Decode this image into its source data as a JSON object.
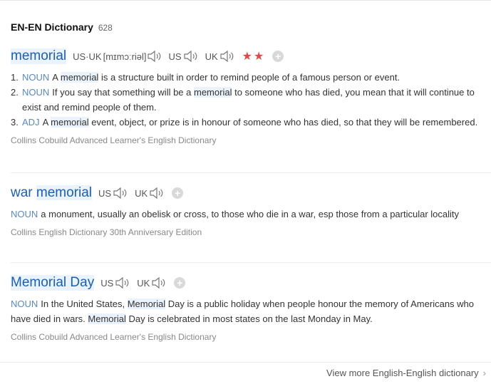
{
  "header": {
    "title": "EN-EN Dictionary",
    "count": "628"
  },
  "entry1": {
    "headword": "memorial",
    "pron_label": "US·UK",
    "ipa": "[mɪmɔːriəl]",
    "us": "US",
    "uk": "UK",
    "stars": "★★",
    "defs": [
      {
        "num": "1.",
        "pos": "NOUN",
        "pre": "A ",
        "hl": "memorial",
        "post": " is a structure built in order to remind people of a famous person or event."
      },
      {
        "num": "2.",
        "pos": "NOUN",
        "pre": "If you say that something will be a ",
        "hl": "memorial",
        "post": " to someone who has died, you mean that it will continue to exist and remind people of them."
      },
      {
        "num": "3.",
        "pos": "ADJ",
        "pre": "A ",
        "hl": "memorial",
        "post": " event, object, or prize is in honour of someone who has died, so that they will be remembered."
      }
    ],
    "source": "Collins Cobuild Advanced Learner's English Dictionary"
  },
  "entry2": {
    "headword_a": "war",
    "headword_b": "memorial",
    "us": "US",
    "uk": "UK",
    "pos": "NOUN",
    "def": "a monument, usually an obelisk or cross, to those who die in a war, esp those from a particular locality",
    "source": "Collins English Dictionary 30th Anniversary Edition"
  },
  "entry3": {
    "headword": "Memorial Day",
    "us": "US",
    "uk": "UK",
    "pos": "NOUN",
    "pre": "In the United States, ",
    "hl1": "Memorial",
    "mid": " Day is a public holiday when people honour the memory of Americans who have died in wars. ",
    "hl2": "Memorial",
    "post": " Day is celebrated in most states on the last Monday in May.",
    "source": "Collins Cobuild Advanced Learner's English Dictionary"
  },
  "footer": {
    "link": "View more English-English dictionary",
    "chevron": "›"
  },
  "icons": {
    "speaker": "speaker-icon",
    "add": "add-circle-icon"
  },
  "colors": {
    "headword": "#1a5fb4",
    "highlight": "#eaf3fb",
    "stars": "#e34848",
    "pos": "#5a88c9"
  }
}
